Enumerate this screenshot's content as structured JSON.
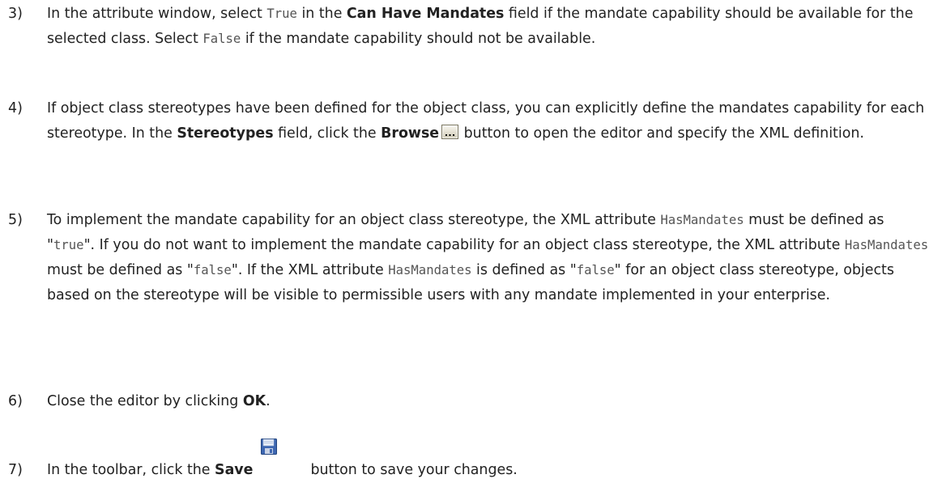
{
  "steps": [
    {
      "number": "3)",
      "parts": {
        "a": "In the attribute window, select ",
        "b_code": "True",
        "c": " in the ",
        "d_bold": "Can Have Mandates",
        "e": " field if the mandate capability should be available for the selected class. Select ",
        "f_code": "False",
        "g": " if the mandate capability should not be available."
      }
    },
    {
      "number": "4)",
      "parts": {
        "a": "If object class stereotypes have been defined for the object class, you can explicitly define the mandates capability for each stereotype. In the ",
        "b_bold": "Stereotypes",
        "c": " field, click the ",
        "d_bold": "Browse",
        "icon": "browse-ellipsis-icon",
        "e": " button to open the editor and specify the XML definition."
      }
    },
    {
      "number": "5)",
      "parts": {
        "a": "To implement the mandate capability for an object class stereotype, the XML attribute ",
        "b_code": "HasMandates",
        "c": " must be defined as \"",
        "d_code": "true",
        "e": "\". If you do not want to implement the mandate capability for an object class stereotype, the XML attribute ",
        "f_code": "HasMandates",
        "g": " must be defined as \"",
        "h_code": "false",
        "i": "\". If the XML attribute ",
        "j_code": "HasMandates",
        "k": " is defined as \"",
        "l_code": "false",
        "m": "\" for an object class stereotype, objects based on the stereotype will be visible to permissible users with any mandate implemented in your enterprise."
      }
    },
    {
      "number": "6)",
      "parts": {
        "a": "Close the editor by clicking ",
        "b_bold": "OK",
        "c": "."
      }
    },
    {
      "number": "7)",
      "parts": {
        "a": "In the toolbar, click the ",
        "b_bold": "Save",
        "icon": "save-floppy-icon",
        "c": "button to save your changes."
      }
    }
  ],
  "colors": {
    "text": "#222222",
    "code": "#555555",
    "background": "#ffffff"
  }
}
